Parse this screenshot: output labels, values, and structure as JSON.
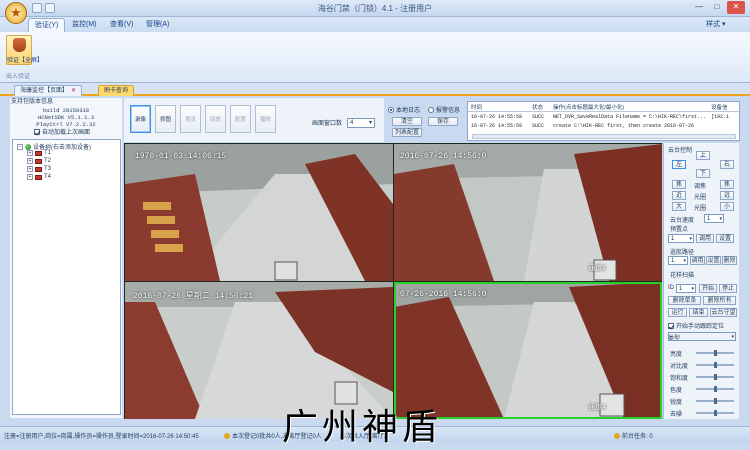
{
  "window": {
    "title": "海谷门禁（门锁）4.1 - 注册用户",
    "style_label": "样式",
    "min": "—",
    "max": "□",
    "close": "✕"
  },
  "menu": {
    "tabs": [
      "验证(Y)",
      "监控(M)",
      "查看(V)",
      "管理(A)"
    ],
    "active": 0
  },
  "ribbon": {
    "button_label": "验证【全屏】",
    "group_label": "出入验证"
  },
  "doc_tabs": [
    "海康监控【页面】",
    "刷卡查询"
  ],
  "left": {
    "info_title": "支持包版本信息",
    "info_lines": [
      "build 20150318",
      "HCNetSDK V5.1.1.3",
      "PlayCtrl V7.2.2.32"
    ],
    "autoload_label": "自动加载上次画面",
    "tree_root": "设备树(右击添加设备)",
    "tree_items": [
      "T1",
      "T2",
      "T3",
      "T4"
    ]
  },
  "video_toolbar": {
    "buttons": [
      "录像",
      "抓图",
      "预览",
      "回放",
      "配置",
      "播放"
    ],
    "split_label": "画面窗口数",
    "split_value": "4"
  },
  "log_controls": {
    "radio_local": "本地日志",
    "radio_alarm": "报警信息",
    "clear": "清空",
    "save": "保存",
    "list_config": "列表配置"
  },
  "log": {
    "headers": [
      "时间",
      "状态",
      "操作(点击标题最大化/最小化)",
      "设备信"
    ],
    "rows": [
      {
        "time": "16-07-26 14:55:59",
        "status": "SUCC",
        "op": "NET_DVR_SaveRealData Filename = C:\\HIK-REC\\first...",
        "dev": "[192.1"
      },
      {
        "time": "16-07-26 14:55:59",
        "status": "SUCC",
        "op": "create C:\\HIK-REC first, then create 2016-07-26",
        "dev": ""
      }
    ]
  },
  "cameras": [
    {
      "osd": "1970-01-03 14:06:15",
      "label": ""
    },
    {
      "osd": "2016-07-26 14:56:0",
      "label": "通道2"
    },
    {
      "osd": "2016-07-26 星期二 14:56:21",
      "label": ""
    },
    {
      "osd": "07-26-2016 14:56:0",
      "label": "通道4"
    }
  ],
  "ptz": {
    "title": "云台控制",
    "dir": {
      "up": "上",
      "left": "左",
      "right": "右",
      "down": "下"
    },
    "rows": [
      [
        "焦",
        "调焦",
        "焦"
      ],
      [
        "近",
        "光圈",
        "远"
      ],
      [
        "大",
        "光圈",
        "小"
      ]
    ],
    "speed_label": "云台速度",
    "speed_value": "1",
    "preset_label": "预置点",
    "preset_value": "1",
    "call": "调用",
    "set": "设置",
    "cruise_label": "巡航路径",
    "cruise_value": "1",
    "cruise_call": "调用",
    "cruise_set": "设置",
    "cruise_del": "删除",
    "pattern_label": "花样扫描",
    "pattern_value": "1",
    "start": "开始",
    "stop": "停止",
    "del_one": "删除单条",
    "del_all": "删除所有",
    "run": "运行",
    "end": "结束",
    "guard": "云台守望",
    "manual_track": "开始手动跟踪定位",
    "type_label": "类型",
    "sliders": [
      "亮度",
      "对比度",
      "饱和度",
      "色度",
      "锐度",
      "去噪"
    ]
  },
  "status": {
    "left": "注册=注册用户,岗位=岗属,操作员=操作员,登录时间=2016-07-26 14:50:45",
    "middle": "本次登记0批共0人,未离厅登记0人",
    "mid2": "本次共入厅 离厅1",
    "right": "前台任务: 0"
  },
  "watermark": "广州神盾"
}
